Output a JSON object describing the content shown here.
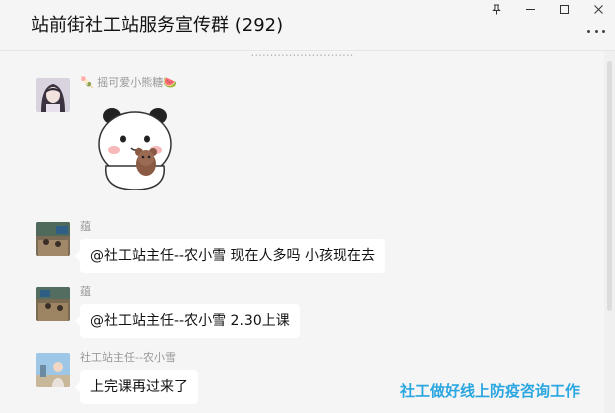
{
  "window": {
    "title": "站前街社工站服务宣传群 (292)"
  },
  "chat": {
    "system_note": "...........................",
    "messages": [
      {
        "sender": "🍡 摇可爱小熊糖🍉",
        "type": "sticker",
        "sticker_name": "panda-bear-sticker"
      },
      {
        "sender": "蕴",
        "type": "text",
        "text": "@社工站主任--农小雪  现在人多吗 小孩现在去"
      },
      {
        "sender": "蕴",
        "type": "text",
        "text": "@社工站主任--农小雪 2.30上课"
      },
      {
        "sender": "社工站主任--农小雪",
        "type": "text",
        "text": "上完课再过来了"
      }
    ]
  },
  "watermark": {
    "text": "社工做好线上防疫咨询工作",
    "color": "#2aa6e0"
  },
  "icons": [
    "pin-icon",
    "minimize-icon",
    "maximize-icon",
    "close-icon",
    "more-icon"
  ]
}
